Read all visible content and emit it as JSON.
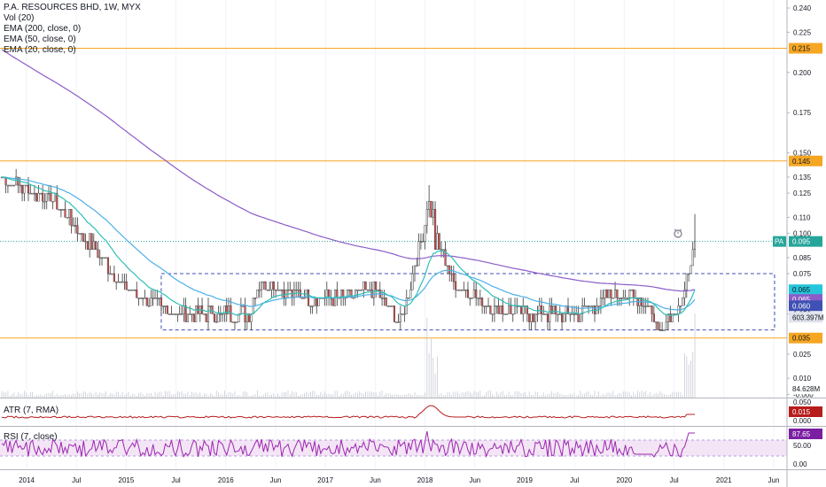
{
  "legend": {
    "title": "P.A. RESOURCES BHD, 1W, MYX",
    "vol": "Vol (20)",
    "ema200": "EMA (200, close, 0)",
    "ema50": "EMA (50, close, 0)",
    "ema20": "EMA (20, close, 0)"
  },
  "atr_legend": "ATR (7, RMA)",
  "rsi_legend": "RSI (7, close)",
  "colors": {
    "up": "#26a69a",
    "down": "#ef5350",
    "candle": "#3a3a3a",
    "ema200": "#8c5cc9",
    "ema50": "#4cb0e8",
    "ema20": "#2fbfb6",
    "hline": "#f5a623",
    "box": "#3f51b5",
    "atr": "#b71c1c",
    "rsi": "#9c27b0"
  },
  "chart_data": [
    {
      "type": "candlestick",
      "title": "P.A. RESOURCES BHD, 1W, MYX",
      "ylim": [
        -0.002,
        0.245
      ],
      "y_ticks": [
        "0.240",
        "0.225",
        "0.200",
        "0.175",
        "0.150",
        "0.135",
        "0.125",
        "0.110",
        "0.100",
        "0.085",
        "0.075",
        "0.050",
        "0.025",
        "0.010",
        "-0.000"
      ],
      "x_ticks": [
        "2014",
        "Jul",
        "2015",
        "Jul",
        "2016",
        "Jun",
        "2017",
        "Jun",
        "2018",
        "Jun",
        "2019",
        "Jul",
        "2020",
        "Jul",
        "2021",
        "Jun"
      ],
      "price_levels": [
        {
          "label": "0.215",
          "value": 0.215
        },
        {
          "label": "0.145",
          "value": 0.145
        },
        {
          "label": "0.035",
          "value": 0.035
        }
      ],
      "range_box": {
        "top": 0.075,
        "bottom": 0.04
      },
      "last_price": {
        "label": "PA",
        "value": "0.095"
      },
      "ema_badges": [
        "0.065",
        "0.065",
        "0.060"
      ],
      "volume_badges": [
        "603.397M",
        "84.628M"
      ],
      "weekly_close_key_points": [
        {
          "date": "2014-01",
          "value": 0.135
        },
        {
          "date": "2014-07",
          "value": 0.12
        },
        {
          "date": "2014-10",
          "value": 0.1
        },
        {
          "date": "2015-01",
          "value": 0.08
        },
        {
          "date": "2015-03",
          "value": 0.065
        },
        {
          "date": "2015-07",
          "value": 0.055
        },
        {
          "date": "2015-09",
          "value": 0.05
        },
        {
          "date": "2016-05",
          "value": 0.05
        },
        {
          "date": "2016-06",
          "value": 0.07
        },
        {
          "date": "2016-12",
          "value": 0.06
        },
        {
          "date": "2017-03",
          "value": 0.06
        },
        {
          "date": "2017-07",
          "value": 0.065
        },
        {
          "date": "2017-10",
          "value": 0.045
        },
        {
          "date": "2018-01",
          "value": 0.11
        },
        {
          "date": "2018-04",
          "value": 0.07
        },
        {
          "date": "2018-08",
          "value": 0.055
        },
        {
          "date": "2019-01",
          "value": 0.05
        },
        {
          "date": "2019-06",
          "value": 0.05
        },
        {
          "date": "2019-11",
          "value": 0.065
        },
        {
          "date": "2020-02",
          "value": 0.055
        },
        {
          "date": "2020-03",
          "value": 0.04
        },
        {
          "date": "2020-06",
          "value": 0.06
        },
        {
          "date": "2020-07",
          "value": 0.095
        }
      ]
    },
    {
      "type": "line",
      "title": "ATR (7, RMA)",
      "y_ticks": [
        "0.050",
        "0.000"
      ],
      "last_value": "0.015"
    },
    {
      "type": "line",
      "title": "RSI (7, close)",
      "y_ticks": [
        "50.00",
        "0.00"
      ],
      "last_value": "87.65",
      "band": [
        30,
        70
      ]
    }
  ]
}
